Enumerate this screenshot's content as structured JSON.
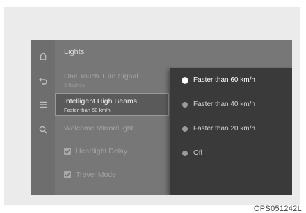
{
  "header": {
    "title": "Lights"
  },
  "menu": {
    "one_touch": {
      "label": "One Touch Turn Signal",
      "sub": "3 flashes"
    },
    "high_beams": {
      "label": "Intelligent High Beams",
      "sub": "Faster than 60 km/h"
    },
    "welcome": {
      "label": "Welcome Mirror/Light"
    },
    "headlight_delay": {
      "label": "Headlight Delay",
      "checked": true
    },
    "travel_mode": {
      "label": "Travel Mode",
      "checked": true
    }
  },
  "rail": {
    "icons": [
      "home-icon",
      "back-icon",
      "menu-icon",
      "search-icon"
    ]
  },
  "popup": {
    "options": [
      {
        "label": "Faster than 60 km/h",
        "selected": true
      },
      {
        "label": "Faster than 40 km/h",
        "selected": false
      },
      {
        "label": "Faster than 20 km/h",
        "selected": false
      },
      {
        "label": "Off",
        "selected": false
      }
    ]
  },
  "figure_code": "OPS051242L"
}
